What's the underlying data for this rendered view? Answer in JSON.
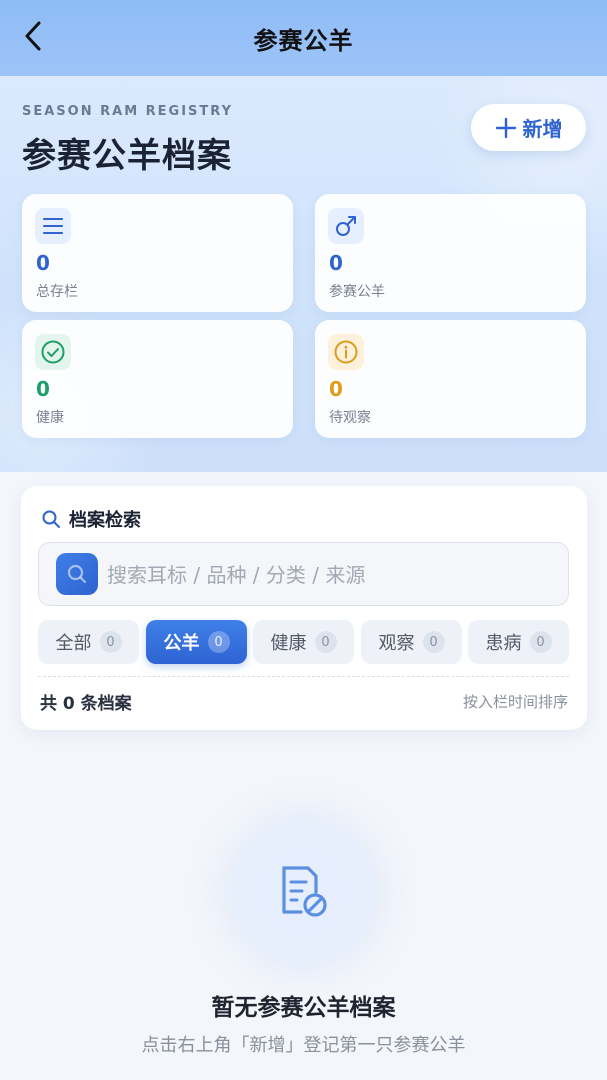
{
  "nav": {
    "title": "参赛公羊"
  },
  "hero": {
    "subtitle": "SEASON RAM REGISTRY",
    "title": "参赛公羊档案",
    "add_label": "新增"
  },
  "stats": [
    {
      "value": "0",
      "label": "总存栏",
      "icon": "list-icon",
      "color": "#2f63cf"
    },
    {
      "value": "0",
      "label": "参赛公羊",
      "icon": "male-icon",
      "color": "#2f63cf"
    },
    {
      "value": "0",
      "label": "健康",
      "icon": "check-circle-icon",
      "color": "#1e9e68"
    },
    {
      "value": "0",
      "label": "待观察",
      "icon": "info-icon",
      "color": "#e29a17"
    }
  ],
  "search": {
    "title": "档案检索",
    "placeholder": "搜索耳标 / 品种 / 分类 / 来源"
  },
  "filters": [
    {
      "label": "全部",
      "count": "0"
    },
    {
      "label": "公羊",
      "count": "0",
      "active": true
    },
    {
      "label": "健康",
      "count": "0"
    },
    {
      "label": "观察",
      "count": "0"
    },
    {
      "label": "患病",
      "count": "0"
    }
  ],
  "summary": {
    "total": "共 0 条档案",
    "sort": "按入栏时间排序"
  },
  "empty": {
    "title": "暂无参赛公羊档案",
    "description": "点击右上角「新增」登记第一只参赛公羊"
  },
  "colors": {
    "accent": "#2f63cf",
    "healthy": "#1e9e68",
    "warning": "#e29a17"
  }
}
